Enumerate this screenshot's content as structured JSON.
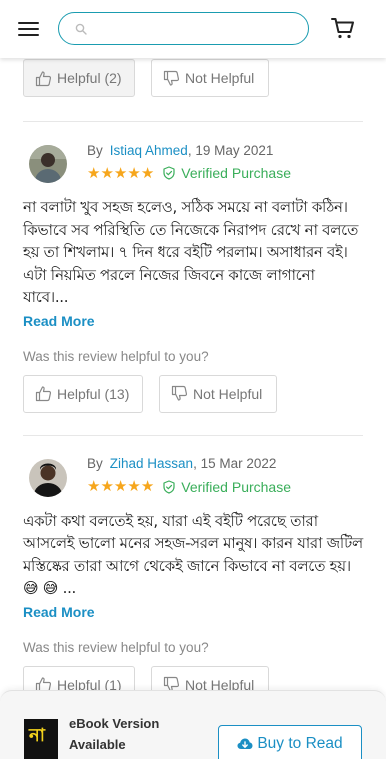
{
  "header": {
    "search_placeholder": ""
  },
  "top_partial": {
    "helpful_label": "Helpful (2)",
    "not_helpful_label": "Not Helpful"
  },
  "reviews": [
    {
      "by_label": "By",
      "author": "Istiaq Ahmed",
      "date": ", 19 May 2021",
      "rating": 5,
      "verified_label": "Verified Purchase",
      "text": "না বলাটা খুব সহজ হলেও, সঠিক সময়ে না বলাটা কঠিন। কিভাবে সব পরিস্থিতি তে নিজেকে নিরাপদ রেখে না বলতে হয় তা শিখলাম। ৭ দিন ধরে বইটি পরলাম। অসাধারন বই। এটা নিয়মিত পরলে নিজের জিবনে কাজে লাগানো যাবে।...",
      "read_more": "Read More",
      "helpful_question": "Was this review helpful to you?",
      "helpful_label": "Helpful (13)",
      "not_helpful_label": "Not Helpful"
    },
    {
      "by_label": "By",
      "author": "Zihad Hassan",
      "date": ", 15 Mar 2022",
      "rating": 5,
      "verified_label": "Verified Purchase",
      "text": "একটা কথা বলতেই হয়, যারা এই বইটি পরেছে তারা আসলেই ভালো মনের সহজ-সরল মানুষ। কারন যারা জটিল মস্তিষ্কের তারা আগে থেকেই জানে কিভাবে না বলতে হয়। 😅 😅 ...",
      "read_more": "Read More",
      "helpful_question": "Was this review helpful to you?",
      "helpful_label": "Helpful (1)",
      "not_helpful_label": "Not Helpful"
    }
  ],
  "footer": {
    "thumb_text": "না",
    "ebook_label": "eBook Version Available",
    "buy_label": "Buy to Read"
  },
  "colors": {
    "accent": "#1b8fc4",
    "search_border": "#1a9cb0",
    "star": "#f6a61c",
    "verified": "#3aae5a"
  },
  "icons": {
    "menu": "hamburger-icon",
    "search": "search-icon",
    "cart": "cart-icon",
    "helpful": "thumbs-up-icon",
    "not_helpful": "thumbs-down-icon",
    "verified": "shield-check-icon",
    "buy": "cloud-download-icon"
  }
}
